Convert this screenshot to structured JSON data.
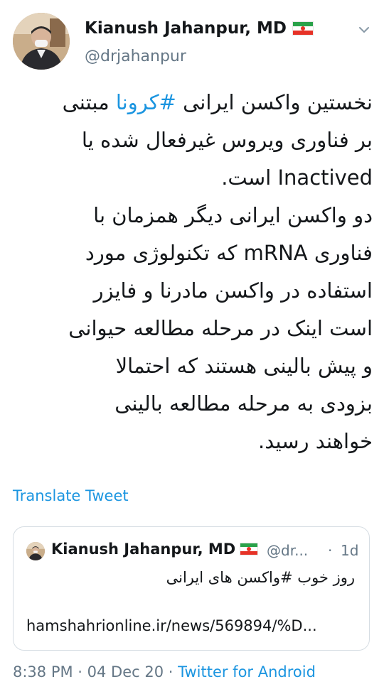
{
  "tweet": {
    "author": {
      "display_name": "Kianush Jahanpur, MD",
      "handle": "@drjahanpur",
      "flag_icon": "iran-flag-icon",
      "avatar_icon": "avatar-photo"
    },
    "more_icon": "chevron-down-icon",
    "text_lines": [
      "نخستین واکسن ایرانی ",
      "#کرونا",
      " مبتنی",
      "بر فناوری ویروس غیرفعال شده یا",
      "Inactived است.",
      "دو واکسن ایرانی دیگر همزمان با",
      "فناوری mRNA که تکنولوژی مورد",
      "استفاده در واکسن مادرنا و فایزر",
      "است اینک در مرحله مطالعه حیوانی",
      "و پیش بالینی  هستند که احتمالا",
      "بزودی به مرحله مطالعه بالینی",
      "خواهند رسید."
    ],
    "translate_label": "Translate Tweet",
    "quoted": {
      "display_name": "Kianush Jahanpur, MD",
      "handle": "@dr...",
      "dot": "·",
      "time": "1d",
      "text": "روز خوب #واکسن های ایرانی",
      "link": "hamshahrionline.ir/news/569894/%D..."
    },
    "footer": {
      "time": "8:38 PM",
      "sep1": " · ",
      "date": "04 Dec 20",
      "sep2": " · ",
      "source": "Twitter for Android"
    }
  },
  "colors": {
    "link_blue": "#1b95e0",
    "muted_gray": "#657786",
    "text_dark": "#14171a",
    "border": "#d6dde3"
  }
}
